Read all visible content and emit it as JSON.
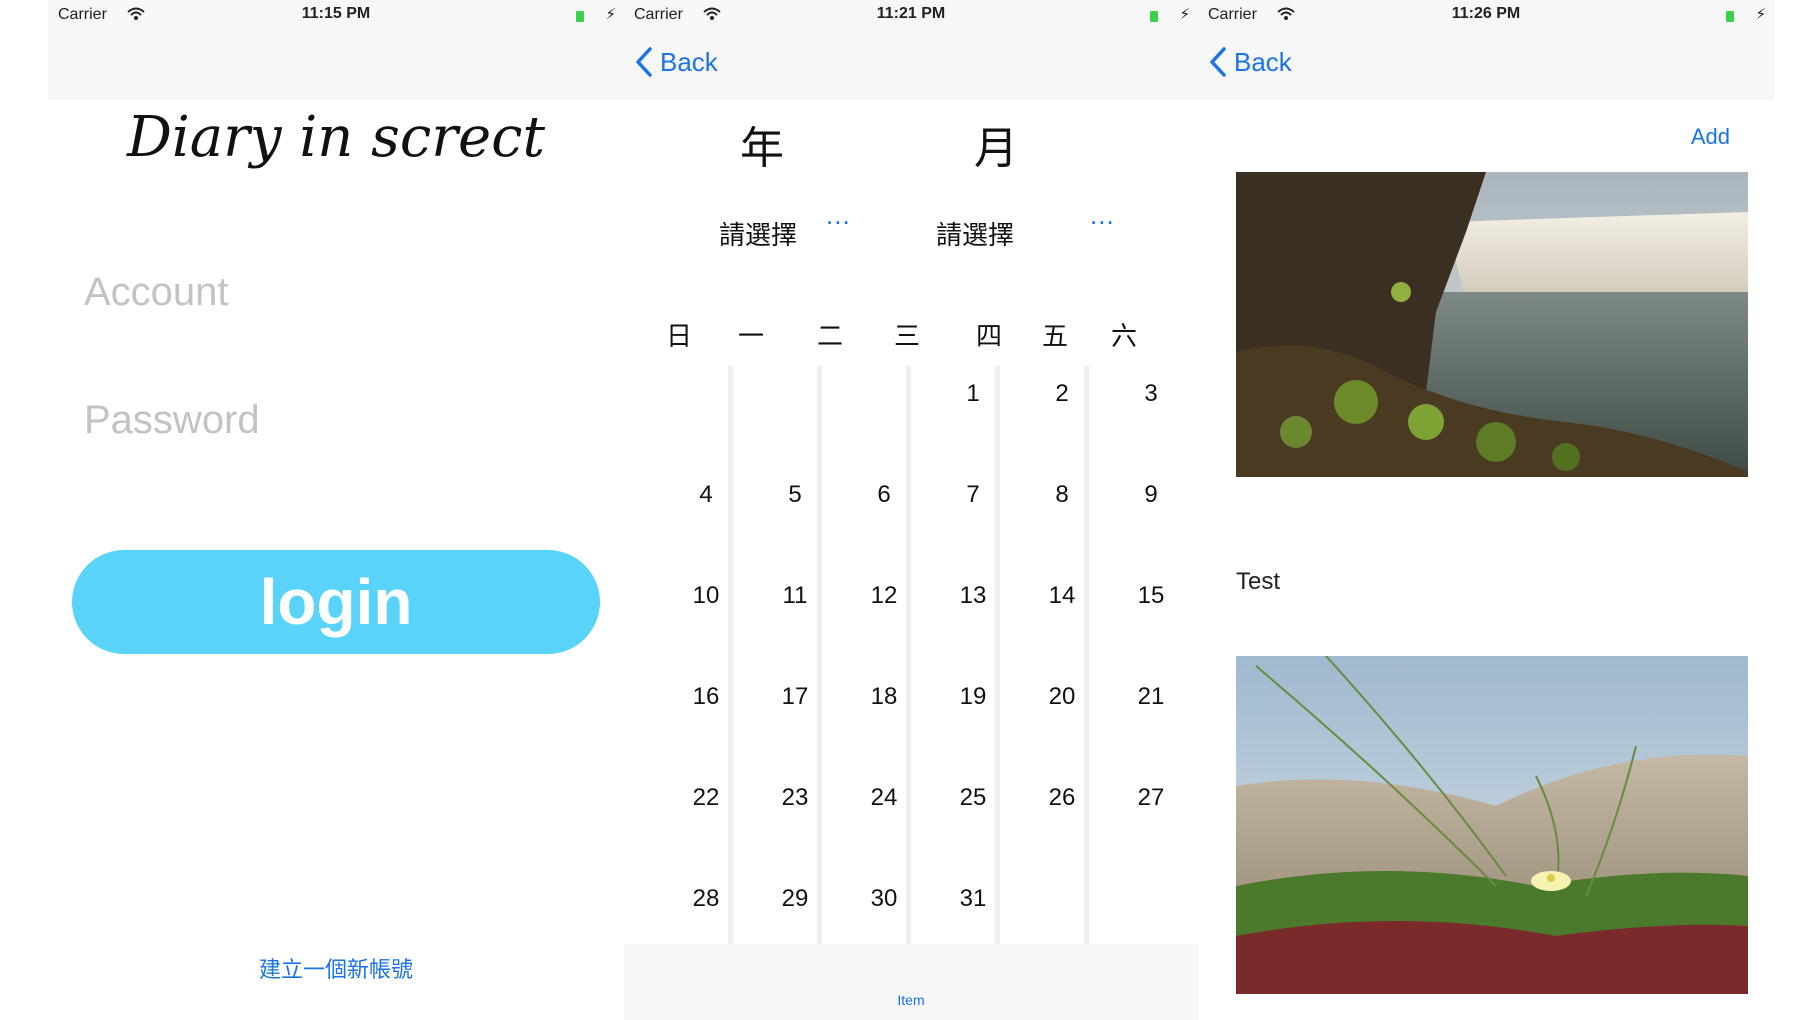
{
  "screens": {
    "login": {
      "status": {
        "carrier": "Carrier",
        "time": "11:15 PM"
      },
      "title": "Diary in screct",
      "account_placeholder": "Account",
      "password_placeholder": "Password",
      "login_label": "login",
      "create_account": "建立一個新帳號"
    },
    "calendar": {
      "status": {
        "carrier": "Carrier",
        "time": "11:21 PM"
      },
      "back": "Back",
      "year_label": "年",
      "month_label": "月",
      "year_picker": "請選擇",
      "month_picker": "請選擇",
      "dots": "...",
      "weekdays": [
        "日",
        "一",
        "二",
        "三",
        "四",
        "五",
        "六"
      ],
      "days": {
        "d1": "1",
        "d2": "2",
        "d3": "3",
        "d4": "4",
        "d5": "5",
        "d6": "6",
        "d7": "7",
        "d8": "8",
        "d9": "9",
        "d10": "10",
        "d11": "11",
        "d12": "12",
        "d13": "13",
        "d14": "14",
        "d15": "15",
        "d16": "16",
        "d17": "17",
        "d18": "18",
        "d19": "19",
        "d20": "20",
        "d21": "21",
        "d22": "22",
        "d23": "23",
        "d24": "24",
        "d25": "25",
        "d26": "26",
        "d27": "27",
        "d28": "28",
        "d29": "29",
        "d30": "30",
        "d31": "31"
      },
      "tab_item": "Item"
    },
    "diary": {
      "status": {
        "carrier": "Carrier",
        "time": "11:26 PM"
      },
      "back": "Back",
      "add": "Add",
      "caption": "Test"
    }
  },
  "colors": {
    "accent": "#1a73e8",
    "login_button": "#5ad3fb",
    "battery": "#39d24a"
  },
  "icons": [
    "wifi-icon",
    "battery-icon",
    "charging-icon",
    "back-chevron-icon"
  ]
}
